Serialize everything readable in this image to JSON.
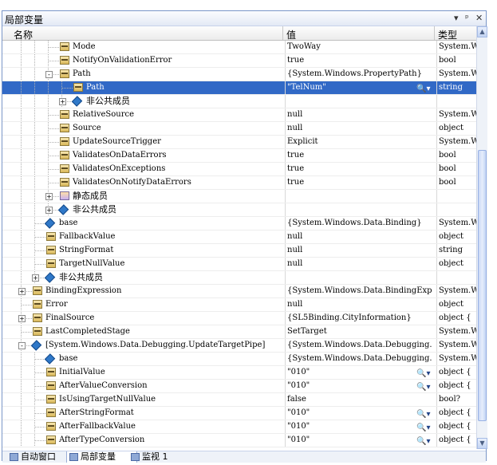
{
  "window": {
    "title": "局部变量",
    "controls": {
      "dropdown": "▾",
      "pin": "ᵖ",
      "close": "✕"
    }
  },
  "columns": {
    "name": "名称",
    "value": "值",
    "type": "类型"
  },
  "rows": [
    {
      "indent": 4,
      "icon": "property",
      "expander": "",
      "name": "Mode",
      "value": "TwoWay",
      "type": "System.W",
      "zh": false
    },
    {
      "indent": 4,
      "icon": "property",
      "expander": "",
      "name": "NotifyOnValidationError",
      "value": "true",
      "type": "bool",
      "zh": false
    },
    {
      "indent": 4,
      "icon": "property",
      "expander": "-",
      "name": "Path",
      "value": "{System.Windows.PropertyPath}",
      "type": "System.W",
      "zh": false
    },
    {
      "indent": 5,
      "icon": "property",
      "expander": "",
      "name": "Path",
      "value": "\"TelNum\"",
      "type": "string",
      "zh": false,
      "selected": true,
      "magnifier": true
    },
    {
      "indent": 5,
      "icon": "field",
      "expander": "+",
      "name": "非公共成员",
      "value": "",
      "type": "",
      "zh": true
    },
    {
      "indent": 4,
      "icon": "property",
      "expander": "",
      "name": "RelativeSource",
      "value": "null",
      "type": "System.W",
      "zh": false
    },
    {
      "indent": 4,
      "icon": "property",
      "expander": "",
      "name": "Source",
      "value": "null",
      "type": "object",
      "zh": false
    },
    {
      "indent": 4,
      "icon": "property",
      "expander": "",
      "name": "UpdateSourceTrigger",
      "value": "Explicit",
      "type": "System.W",
      "zh": false
    },
    {
      "indent": 4,
      "icon": "property",
      "expander": "",
      "name": "ValidatesOnDataErrors",
      "value": "true",
      "type": "bool",
      "zh": false
    },
    {
      "indent": 4,
      "icon": "property",
      "expander": "",
      "name": "ValidatesOnExceptions",
      "value": "true",
      "type": "bool",
      "zh": false
    },
    {
      "indent": 4,
      "icon": "property",
      "expander": "",
      "name": "ValidatesOnNotifyDataErrors",
      "value": "true",
      "type": "bool",
      "zh": false
    },
    {
      "indent": 4,
      "icon": "static",
      "expander": "+",
      "name": "静态成员",
      "value": "",
      "type": "",
      "zh": true
    },
    {
      "indent": 4,
      "icon": "field",
      "expander": "+",
      "name": "非公共成员",
      "value": "",
      "type": "",
      "zh": true
    },
    {
      "indent": 3,
      "icon": "field",
      "expander": "",
      "name": "base",
      "value": "{System.Windows.Data.Binding}",
      "type": "System.W",
      "zh": false
    },
    {
      "indent": 3,
      "icon": "property",
      "expander": "",
      "name": "FallbackValue",
      "value": "null",
      "type": "object",
      "zh": false
    },
    {
      "indent": 3,
      "icon": "property",
      "expander": "",
      "name": "StringFormat",
      "value": "null",
      "type": "string",
      "zh": false
    },
    {
      "indent": 3,
      "icon": "property",
      "expander": "",
      "name": "TargetNullValue",
      "value": "null",
      "type": "object",
      "zh": false
    },
    {
      "indent": 3,
      "icon": "field",
      "expander": "+",
      "name": "非公共成员",
      "value": "",
      "type": "",
      "zh": true
    },
    {
      "indent": 2,
      "icon": "property",
      "expander": "+",
      "name": "BindingExpression",
      "value": "{System.Windows.Data.BindingExp",
      "type": "System.W",
      "zh": false
    },
    {
      "indent": 2,
      "icon": "property",
      "expander": "",
      "name": "Error",
      "value": "null",
      "type": "object",
      "zh": false
    },
    {
      "indent": 2,
      "icon": "property",
      "expander": "+",
      "name": "FinalSource",
      "value": "{SL5Binding.CityInformation}",
      "type": "object {",
      "zh": false
    },
    {
      "indent": 2,
      "icon": "property",
      "expander": "",
      "name": "LastCompletedStage",
      "value": "SetTarget",
      "type": "System.W",
      "zh": false
    },
    {
      "indent": 2,
      "icon": "field",
      "expander": "-",
      "name": "[System.Windows.Data.Debugging.UpdateTargetPipe]",
      "value": "{System.Windows.Data.Debugging.",
      "type": "System.W",
      "zh": false
    },
    {
      "indent": 3,
      "icon": "field",
      "expander": "",
      "name": "base",
      "value": "{System.Windows.Data.Debugging.",
      "type": "System.W",
      "zh": false
    },
    {
      "indent": 3,
      "icon": "property",
      "expander": "",
      "name": "InitialValue",
      "value": "\"010\"",
      "type": "object {",
      "zh": false,
      "magnifier": true
    },
    {
      "indent": 3,
      "icon": "property",
      "expander": "",
      "name": "AfterValueConversion",
      "value": "\"010\"",
      "type": "object {",
      "zh": false,
      "magnifier": true
    },
    {
      "indent": 3,
      "icon": "property",
      "expander": "",
      "name": "IsUsingTargetNullValue",
      "value": "false",
      "type": "bool?",
      "zh": false
    },
    {
      "indent": 3,
      "icon": "property",
      "expander": "",
      "name": "AfterStringFormat",
      "value": "\"010\"",
      "type": "object {",
      "zh": false,
      "magnifier": true
    },
    {
      "indent": 3,
      "icon": "property",
      "expander": "",
      "name": "AfterFallbackValue",
      "value": "\"010\"",
      "type": "object {",
      "zh": false,
      "magnifier": true
    },
    {
      "indent": 3,
      "icon": "property",
      "expander": "",
      "name": "AfterTypeConversion",
      "value": "\"010\"",
      "type": "object {",
      "zh": false,
      "magnifier": true
    }
  ],
  "magnifier_glyph": "🔍▾",
  "scroll": {
    "up": "▲",
    "down": "▼",
    "grip": "≡"
  },
  "tabs": [
    {
      "label": "自动窗口",
      "active": false
    },
    {
      "label": "局部变量",
      "active": true
    },
    {
      "label": "监视 1",
      "active": false
    }
  ],
  "colors": {
    "selection": "#3169c6",
    "border": "#7a96c8"
  }
}
